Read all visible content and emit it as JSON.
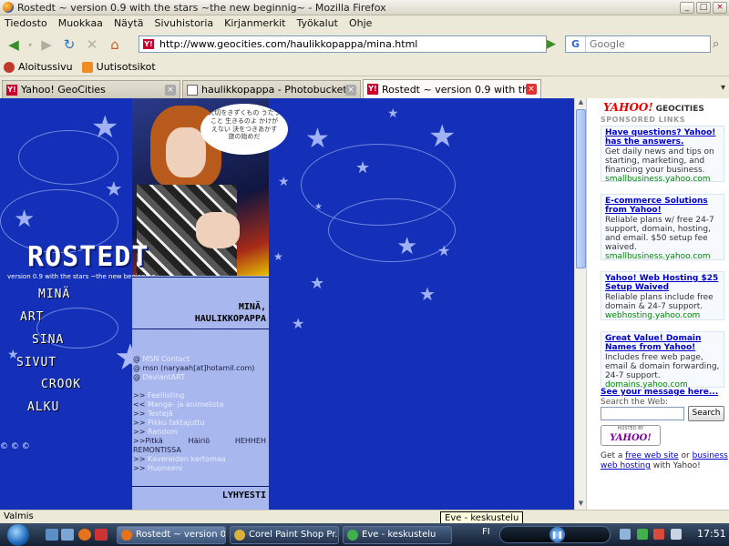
{
  "window": {
    "title": "Rostedt ~ version 0.9 with the stars ~the new beginnig~ - Mozilla Firefox"
  },
  "menu": [
    "Tiedosto",
    "Muokkaa",
    "Näytä",
    "Sivuhistoria",
    "Kirjanmerkit",
    "Työkalut",
    "Ohje"
  ],
  "navbar": {
    "url": "http://www.geocities.com/haulikkopappa/mina.html",
    "search_placeholder": "Google",
    "search_engine": "G"
  },
  "bookmarks": [
    {
      "label": "Aloitussivu",
      "icon": "firefox-icon",
      "color": "#c0392b"
    },
    {
      "label": "Uutisotsikot",
      "icon": "rss-icon",
      "color": "#f08a24"
    }
  ],
  "tabs": [
    {
      "label": "Yahoo! GeoCities",
      "active": false,
      "icon": "Y!"
    },
    {
      "label": "haulikkopappa - Photobucket - Vid...",
      "active": false,
      "icon": ""
    },
    {
      "label": "Rostedt ~ version 0.9 with the st...",
      "active": true,
      "icon": "Y!"
    }
  ],
  "page": {
    "logo": "ROSTEDT",
    "logo_sub": "version 0.9 with the stars ~the new beginning~",
    "bubble_text": "大切をきずくもの うたうこと 生きるのよ かけがえない 決をつきあかす 旅の始めだ",
    "nav": [
      "MINÄ",
      "ART",
      "SINA",
      "SIVUT",
      "CROOK",
      "ALKU"
    ],
    "copyright": "© © ©",
    "panel_title_line1": "MINÄ,",
    "panel_title_line2": "HAULIKKOPAPPA",
    "contact": [
      {
        "prefix": "@",
        "text": "MSN Contact"
      },
      {
        "prefix": "@",
        "text": "msn (naryaah[at]hotamil.com)"
      },
      {
        "prefix": "@",
        "text": "DeviantART"
      }
    ],
    "links": [
      {
        "prefix": ">>",
        "text": "Feellisting"
      },
      {
        "prefix": "<<",
        "text": "Manga- ja animelista"
      },
      {
        "prefix": ">>",
        "text": "Testejä"
      },
      {
        "prefix": ">>",
        "text": "Pikku faktajuttu"
      },
      {
        "prefix": ">>",
        "text": "Random"
      }
    ],
    "pitka_words": [
      "Pitkä",
      "Häiriö",
      "HEHHEH"
    ],
    "pitka_cont": "REMONTISSA",
    "links2": [
      {
        "prefix": ">>",
        "text": "Kavereiden kertomaa"
      },
      {
        "prefix": ">>",
        "text": "Huoneeni"
      }
    ],
    "panel_title2": "LYHYESTI"
  },
  "sidebar": {
    "logo": "YAHOO!",
    "geo": "GEOCITIES",
    "sponsored": "SPONSORED LINKS",
    "ads": [
      {
        "title": "Have questions? Yahoo! has the answers.",
        "body": "Get daily news and tips on starting, marketing, and financing your business.",
        "url": "smallbusiness.yahoo.com"
      },
      {
        "title": "E-commerce Solutions from Yahoo!",
        "body": "Reliable plans w/ free 24-7 support, domain, hosting, and email. $50 setup fee waived.",
        "url": "smallbusiness.yahoo.com"
      },
      {
        "title": "Yahoo! Web Hosting $25 Setup Waived",
        "body": "Reliable plans include free domain & 24-7 support.",
        "url": "webhosting.yahoo.com"
      },
      {
        "title": "Great Value! Domain Names from Yahoo!",
        "body": "Includes free web page, email & domain forwarding, 24-7 support.",
        "url": "domains.yahoo.com"
      }
    ],
    "see_message": "See your message here...",
    "search_label": "Search the Web:",
    "search_button": "Search",
    "hosted_by": "HOSTED BY",
    "hosted_logo": "YAHOO!",
    "get_a": "Get a",
    "free_web_site": "free web site",
    "or": "or",
    "business_web_hosting": "business web hosting",
    "with_yahoo": "with Yahoo!"
  },
  "status": {
    "text": "Valmis",
    "tooltip": "Eve - keskustelu"
  },
  "taskbar": {
    "tasks": [
      {
        "label": "Rostedt ~ version 0....",
        "color": "#e6731b",
        "active": true
      },
      {
        "label": "Corel Paint Shop Pr...",
        "color": "#d9b13b",
        "active": false
      },
      {
        "label": "Eve - keskustelu",
        "color": "#3fb04a",
        "active": false
      }
    ],
    "lang": "FI",
    "clock": "17:51"
  }
}
